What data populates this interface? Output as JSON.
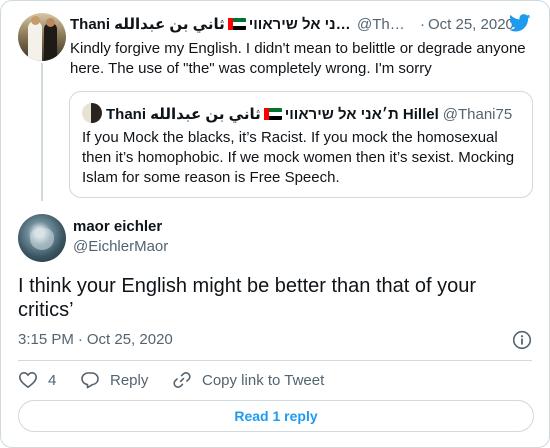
{
  "parent_tweet": {
    "display_name": "Thani ת׳אני אל שיראווי",
    "display_name_ar": "ثاني بن عبدالله Hillel",
    "handle": "@Th…",
    "separator": "·",
    "date": "Oct 25, 2020",
    "text": "Kindly forgive my English. I didn't mean to belittle or degrade anyone here. The use of \"the\" was completely wrong. I'm sorry"
  },
  "quoted_tweet": {
    "display_name": "Thani ת׳אני אל שיראווי",
    "display_name_ar": "ثاني بن عبدالله Hillel",
    "handle": "@Thani75",
    "text": "If you Mock the blacks, it’s Racist. If you mock the homosexual then it’s homophobic. If we mock women then it’s sexist. Mocking Islam for some reason is Free Speech."
  },
  "main_tweet": {
    "display_name": "maor eichler",
    "handle": "@EichlerMaor",
    "text": "I think your English might be better than that of your critics’",
    "time": "3:15 PM",
    "separator": "·",
    "date": "Oct 25, 2020"
  },
  "actions": {
    "like_count": "4",
    "reply_label": "Reply",
    "copy_link_label": "Copy link to Tweet"
  },
  "read_replies_label": "Read 1 reply",
  "icons": {
    "brand": "twitter-bird-icon",
    "info": "info-icon",
    "like": "heart-icon",
    "reply": "reply-bubble-icon",
    "copy": "link-icon",
    "flag": "uae-flag-icon"
  },
  "colors": {
    "accent": "#1d9bf0",
    "text": "#0f1419",
    "secondary": "#536471",
    "border": "#cfd9de"
  }
}
